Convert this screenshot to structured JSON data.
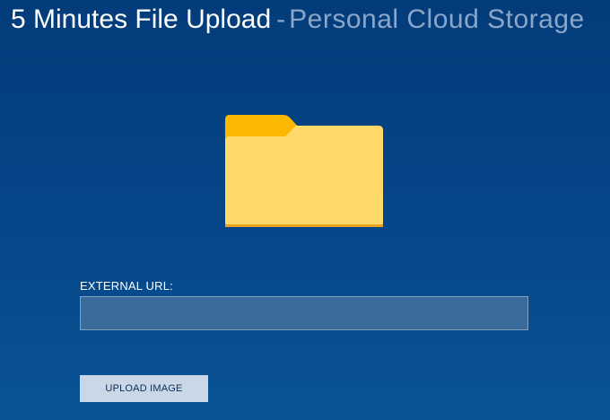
{
  "header": {
    "title": "5 Minutes File Upload",
    "separator": "-",
    "subtitle": "Personal Cloud Storage"
  },
  "folder_icon": {
    "icon": "folder-icon",
    "colors": {
      "tab": "#fbb800",
      "body": "#ffd96a",
      "shadow": "#e8a31d"
    }
  },
  "form": {
    "url_label": "EXTERNAL URL:",
    "url_value": "",
    "upload_button_label": "UPLOAD IMAGE"
  },
  "colors": {
    "background": "#05478a",
    "input_bg": "#3a6b9a",
    "button_bg": "#c9d7e6",
    "button_text": "#0d2d55"
  }
}
